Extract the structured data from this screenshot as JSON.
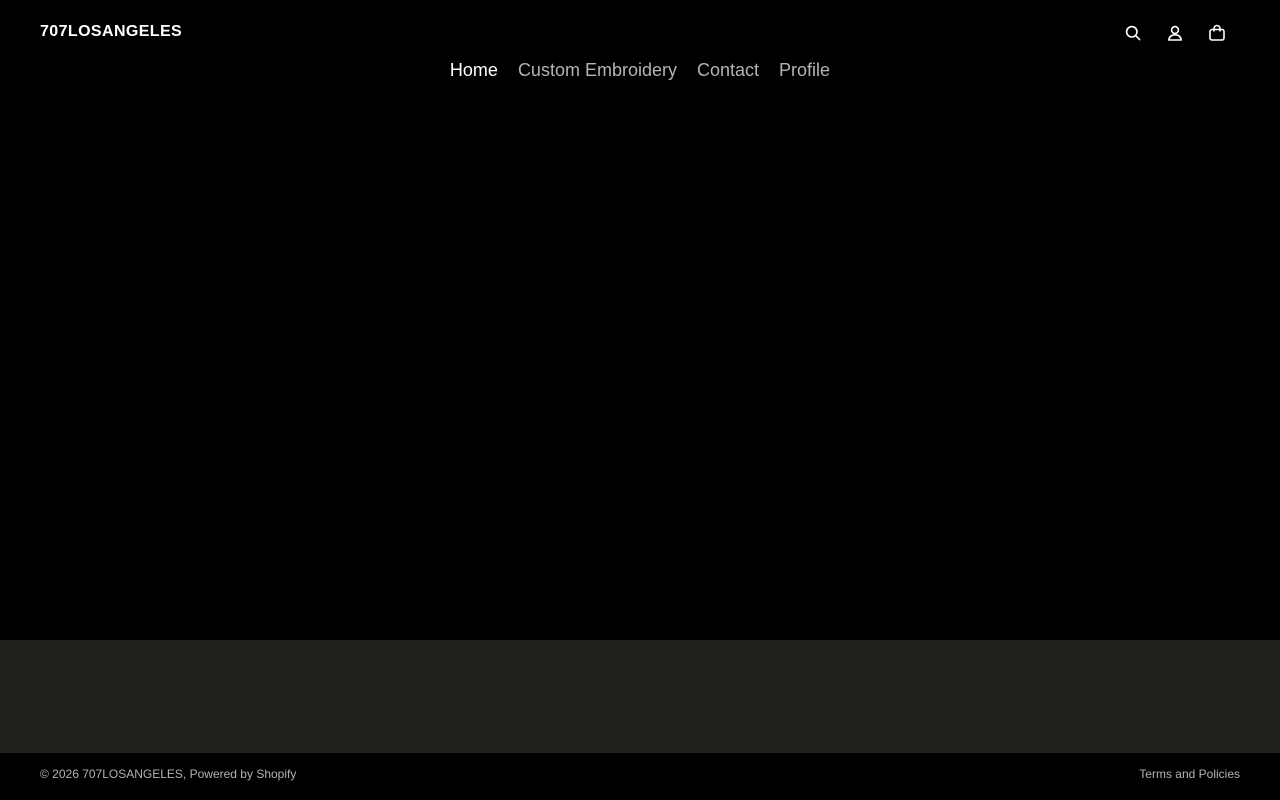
{
  "header": {
    "logo": "707LOSANGELES",
    "icons": [
      "search-icon",
      "account-icon",
      "cart-icon"
    ],
    "nav": [
      {
        "label": "Home",
        "active": true
      },
      {
        "label": "Custom Embroidery",
        "active": false
      },
      {
        "label": "Contact",
        "active": false
      },
      {
        "label": "Profile",
        "active": false
      }
    ]
  },
  "footer": {
    "copyright_prefix": "© 2026 707LOSANGELES,",
    "powered_by": "Powered by Shopify",
    "policies": "Terms and Policies"
  },
  "colors": {
    "background": "#000000",
    "footer_band": "#20211c",
    "text_primary": "#ffffff",
    "text_muted": "#b3b3b3"
  }
}
